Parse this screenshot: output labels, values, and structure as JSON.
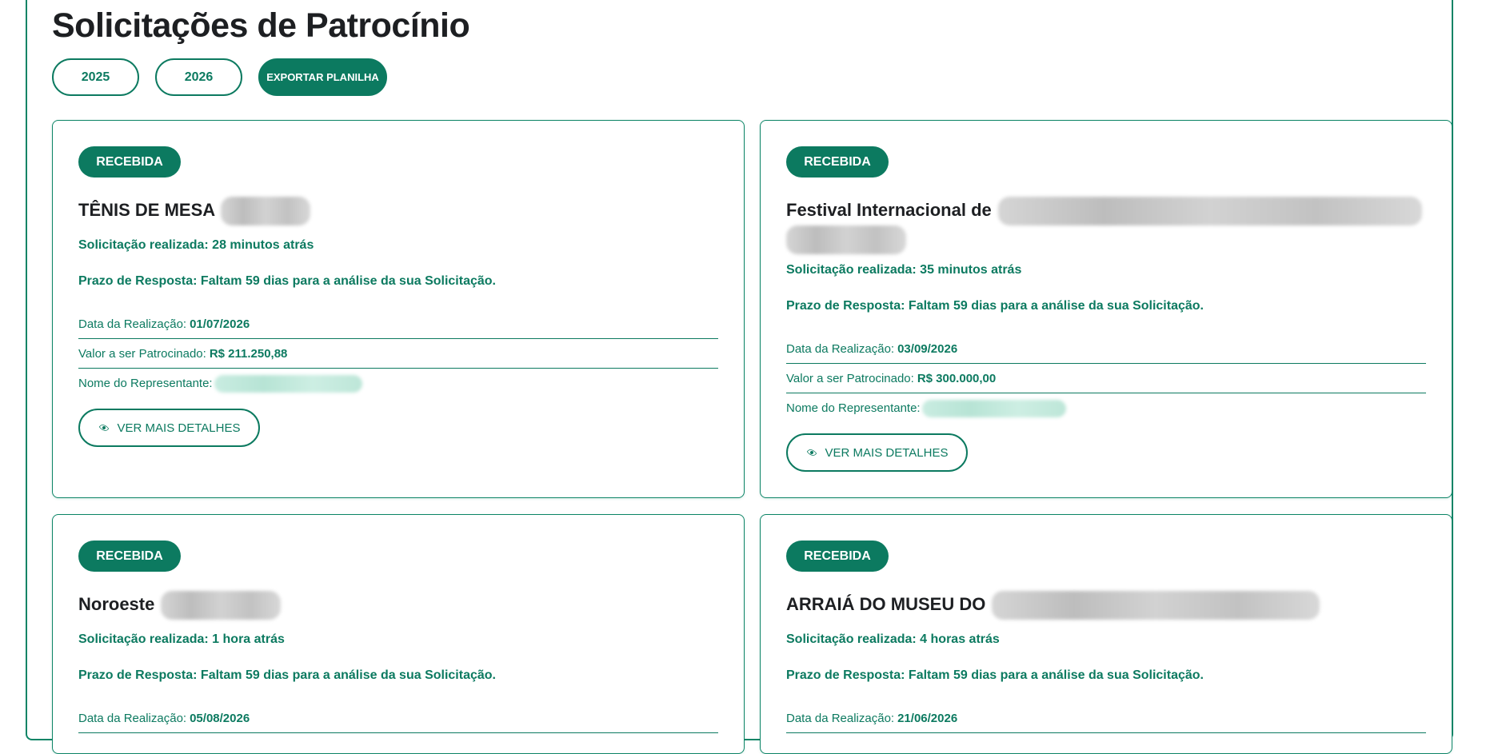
{
  "page": {
    "title": "Solicitações de Patrocínio"
  },
  "filters": {
    "year_1": "2025",
    "year_2": "2026",
    "export_label": "EXPORTAR PLANILHA"
  },
  "labels": {
    "status": "RECEBIDA",
    "data_realizacao": "Data da Realização:",
    "valor": "Valor a ser Patrocinado:",
    "representante": "Nome do Representante:",
    "details_button": "VER MAIS DETALHES"
  },
  "cards": [
    {
      "title": "TÊNIS DE MESA",
      "requested": "Solicitação realizada: 28 minutos atrás",
      "deadline": "Prazo de Resposta: Faltam 59 dias para a análise da sua Solicitação.",
      "date": "01/07/2026",
      "value": "R$ 211.250,88"
    },
    {
      "title": "Festival Internacional de",
      "requested": "Solicitação realizada: 35 minutos atrás",
      "deadline": "Prazo de Resposta: Faltam 59 dias para a análise da sua Solicitação.",
      "date": "03/09/2026",
      "value": "R$ 300.000,00"
    },
    {
      "title": "Noroeste",
      "requested": "Solicitação realizada: 1 hora atrás",
      "deadline": "Prazo de Resposta: Faltam 59 dias para a análise da sua Solicitação.",
      "date": "05/08/2026"
    },
    {
      "title": "ARRAIÁ DO MUSEU DO",
      "requested": "Solicitação realizada: 4 horas atrás",
      "deadline": "Prazo de Resposta: Faltam 59 dias para a análise da sua Solicitação.",
      "date": "21/06/2026"
    }
  ],
  "colors": {
    "accent": "#0c7a60",
    "border": "#0c8466"
  }
}
